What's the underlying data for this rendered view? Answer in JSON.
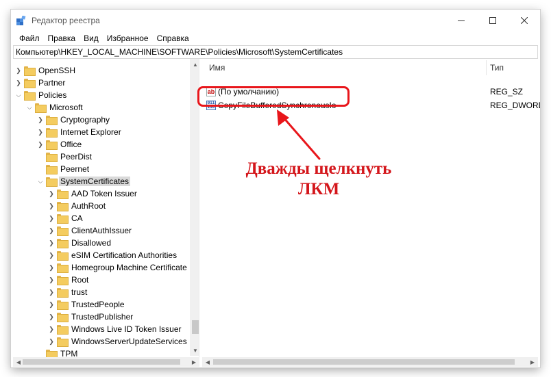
{
  "window": {
    "title": "Редактор реестра"
  },
  "menu": [
    "Файл",
    "Правка",
    "Вид",
    "Избранное",
    "Справка"
  ],
  "address": "Компьютер\\HKEY_LOCAL_MACHINE\\SOFTWARE\\Policies\\Microsoft\\SystemCertificates",
  "tree": [
    {
      "label": "OpenSSH"
    },
    {
      "label": "Partner"
    },
    {
      "label": "Policies"
    },
    {
      "label": "Microsoft"
    },
    {
      "label": "Cryptography"
    },
    {
      "label": "Internet Explorer"
    },
    {
      "label": "Office"
    },
    {
      "label": "PeerDist"
    },
    {
      "label": "Peernet"
    },
    {
      "label": "SystemCertificates"
    },
    {
      "label": "AAD Token Issuer"
    },
    {
      "label": "AuthRoot"
    },
    {
      "label": "CA"
    },
    {
      "label": "ClientAuthIssuer"
    },
    {
      "label": "Disallowed"
    },
    {
      "label": "eSIM Certification Authorities"
    },
    {
      "label": "Homegroup Machine Certificate"
    },
    {
      "label": "Root"
    },
    {
      "label": "trust"
    },
    {
      "label": "TrustedPeople"
    },
    {
      "label": "TrustedPublisher"
    },
    {
      "label": "Windows Live ID Token Issuer"
    },
    {
      "label": "WindowsServerUpdateServices"
    },
    {
      "label": "TPM"
    }
  ],
  "list": {
    "columns": {
      "name": "Имя",
      "type": "Тип"
    },
    "rows": [
      {
        "name": "(По умолчанию)",
        "type": "REG_SZ",
        "icon": "ab-string-icon"
      },
      {
        "name": "CopyFileBufferedSynchronousIo",
        "type": "REG_DWORD",
        "icon": "binary-value-icon"
      }
    ]
  },
  "annotation": {
    "line1": "Дважды щелкнуть",
    "line2": "ЛКМ",
    "color": "#d4161b"
  }
}
